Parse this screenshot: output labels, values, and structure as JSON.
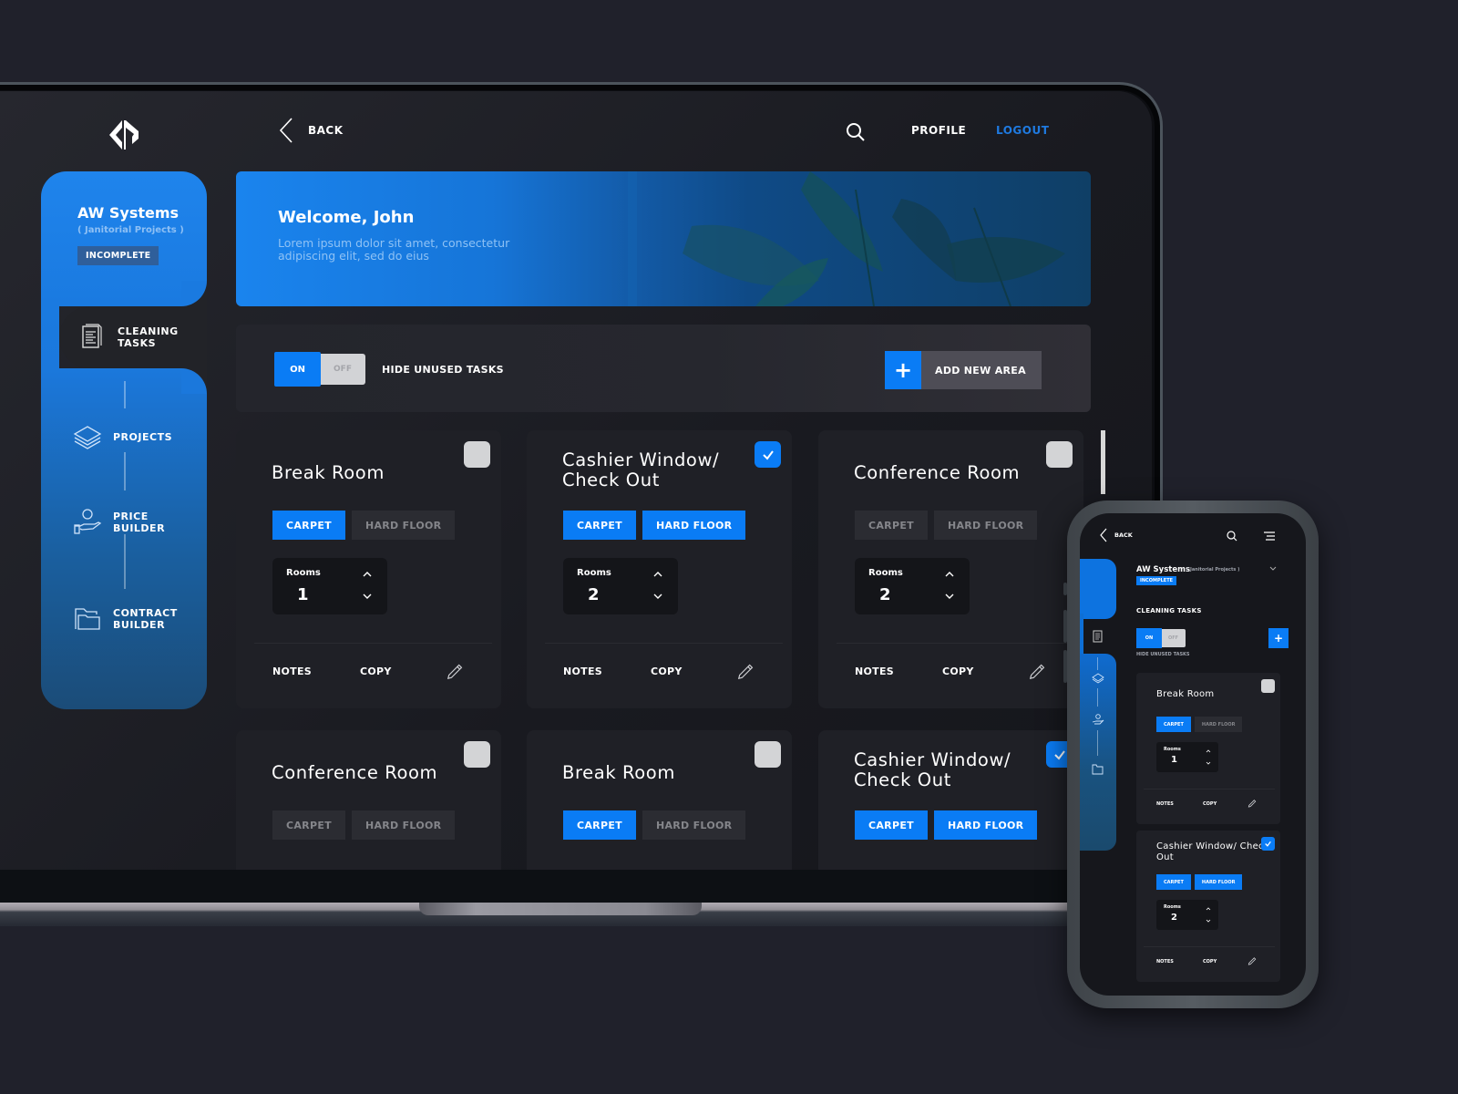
{
  "colors": {
    "accent": "#0a7cf5",
    "logout": "#1f7ae0",
    "background": "#20212b",
    "card": "#1f2026"
  },
  "nav": {
    "back_label": "BACK",
    "profile_label": "PROFILE",
    "logout_label": "LOGOUT",
    "logo_icon": "brand-logo-icon",
    "search_icon": "search-icon"
  },
  "sidebar": {
    "company_name": "AW Systems",
    "company_subtitle": "( Janitorial Projects )",
    "status": "INCOMPLETE",
    "items": [
      {
        "label": "CLEANING TASKS",
        "icon": "document-icon",
        "active": true
      },
      {
        "label": "PROJECTS",
        "icon": "layers-icon",
        "active": false
      },
      {
        "label": "PRICE BUILDER",
        "icon": "hand-coin-icon",
        "active": false
      },
      {
        "label": "CONTRACT BUILDER",
        "icon": "folder-icon",
        "active": false
      }
    ]
  },
  "banner": {
    "title": "Welcome, John",
    "text": "Lorem ipsum dolor sit amet, consectetur adipiscing elit, sed do eius"
  },
  "controls": {
    "toggle_on": "ON",
    "toggle_off": "OFF",
    "toggle_state": "on",
    "toggle_label": "HIDE UNUSED TASKS",
    "add_area_label": "ADD NEW AREA",
    "add_icon": "+"
  },
  "card_labels": {
    "carpet": "CARPET",
    "hard_floor": "HARD FLOOR",
    "rooms": "Rooms",
    "notes": "NOTES",
    "copy": "COPY"
  },
  "cards": [
    {
      "title": "Break Room",
      "checked": false,
      "carpet": true,
      "hard_floor": false,
      "rooms": "1"
    },
    {
      "title": "Cashier Window/ Check Out",
      "checked": true,
      "carpet": true,
      "hard_floor": true,
      "rooms": "2"
    },
    {
      "title": "Conference Room",
      "checked": false,
      "carpet": false,
      "hard_floor": false,
      "rooms": "2"
    },
    {
      "title": "Conference Room",
      "checked": false,
      "carpet": false,
      "hard_floor": false
    },
    {
      "title": "Break Room",
      "checked": false,
      "carpet": true,
      "hard_floor": false
    },
    {
      "title": "Cashier Window/ Check Out",
      "checked": true,
      "carpet": true,
      "hard_floor": true
    }
  ],
  "phone": {
    "back_label": "BACK",
    "company_name": "AW Systems",
    "company_subtitle": "( Janitorial Projects )",
    "status": "INCOMPLETE",
    "section_title": "CLEANING TASKS",
    "toggle_on": "ON",
    "toggle_off": "OFF",
    "hide_label": "HIDE UNUSED TASKS",
    "add_icon": "+",
    "cards": [
      {
        "title": "Break Room",
        "checked": false,
        "carpet": true,
        "hard_floor": false,
        "rooms": "1"
      },
      {
        "title": "Cashier Window/ Check Out",
        "checked": true,
        "carpet": true,
        "hard_floor": true,
        "rooms": "2"
      }
    ]
  }
}
